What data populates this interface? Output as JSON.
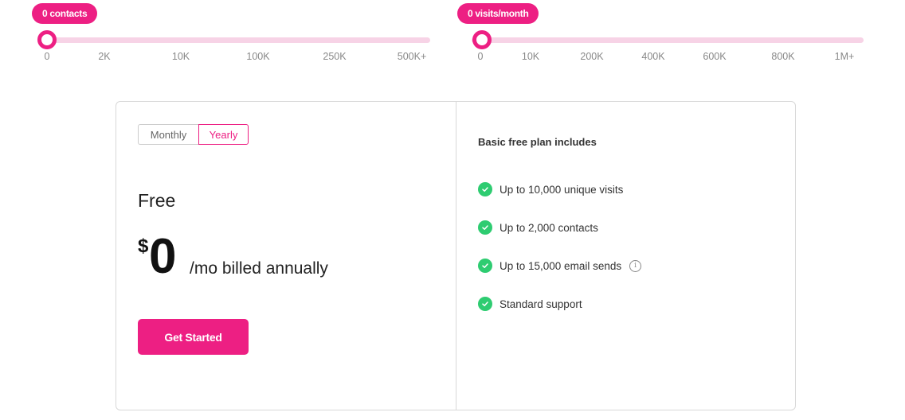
{
  "sliders": {
    "contacts": {
      "badge": "0 contacts",
      "value": 0,
      "ticks": [
        "0",
        "2K",
        "10K",
        "100K",
        "250K",
        "500K+"
      ]
    },
    "visits": {
      "badge": "0 visits/month",
      "value": 0,
      "ticks": [
        "0",
        "10K",
        "200K",
        "400K",
        "600K",
        "800K",
        "1M+"
      ]
    }
  },
  "billing_toggle": {
    "options": [
      "Monthly",
      "Yearly"
    ],
    "selected": "Yearly"
  },
  "plan": {
    "name": "Free",
    "currency": "$",
    "amount": "0",
    "period": "/mo billed annually",
    "cta": "Get Started"
  },
  "features": {
    "title": "Basic free plan includes",
    "items": [
      {
        "text": "Up to 10,000 unique visits",
        "info": false
      },
      {
        "text": "Up to 2,000 contacts",
        "info": false
      },
      {
        "text": "Up to 15,000 email sends",
        "info": true
      },
      {
        "text": "Standard support",
        "info": false
      }
    ]
  },
  "colors": {
    "accent": "#ed1f83",
    "track": "#f7d3e6",
    "check": "#2ecc71"
  }
}
